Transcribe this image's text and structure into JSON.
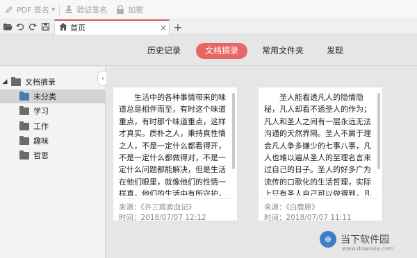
{
  "toolbar": {
    "pdf_sign_label": "PDF 签名",
    "verify_sign_label": "验证签名",
    "encrypt_label": "加密"
  },
  "tabs": {
    "home_title": "首页",
    "close_glyph": "×",
    "new_tab_glyph": "+"
  },
  "nav": {
    "items": [
      "历史记录",
      "文档摘录",
      "常用文件夹",
      "发现"
    ],
    "active_index": 1
  },
  "sidebar": {
    "root": {
      "label": "文档摘录",
      "arrow": "◢"
    },
    "children": [
      "未分类",
      "学习",
      "工作",
      "趣味",
      "哲思"
    ],
    "selected_index": 0,
    "collapse_glyph": "‹"
  },
  "cards": [
    {
      "text": "生活中的各种事情带来的味道总是相伴而至，有时这个味道重点，有时那个味道重点，这样才真实。质朴之人，秉持真性情之人，不是一定什么都看得开，不是一定什么都做得对，不是一定什么问题都能解决，但是生活在他们眼里，就像他们的性情一样真，他们的生活中有所守护，有所坚持，有所为，有所不为，他们的生活即使无",
      "source": "来源：《许三观卖血记》",
      "time": "时间：2018/07/07 12:12"
    },
    {
      "text": "圣人能看透凡人的隐情隐秘，凡人却看不透圣人的作为；凡人和圣人之间有一层永远无法沟通的天然界隔。圣人不屑于理会凡人争多嫌少的七事八事，凡人也难以遍从圣人的至理名言来过自己的日子。圣人的好多广为流传的口歌化的生活哲理，实际上只有圣人自己可以做得到，凡人是根本无法做到的。凡人们绝对信服圣人的圣言而又不",
      "source": "来源：《白鹿原》",
      "time": "时间：2018/07/07 11:11"
    }
  ],
  "watermark": {
    "logo_glyph": "⊕",
    "text": "当下软件园",
    "url": "www.downxia.com"
  },
  "colors": {
    "accent": "#e86666",
    "tab_accent": "#e05a5a",
    "folder_selected": "#4a7bb5",
    "folder_default": "#6b6b6b"
  }
}
